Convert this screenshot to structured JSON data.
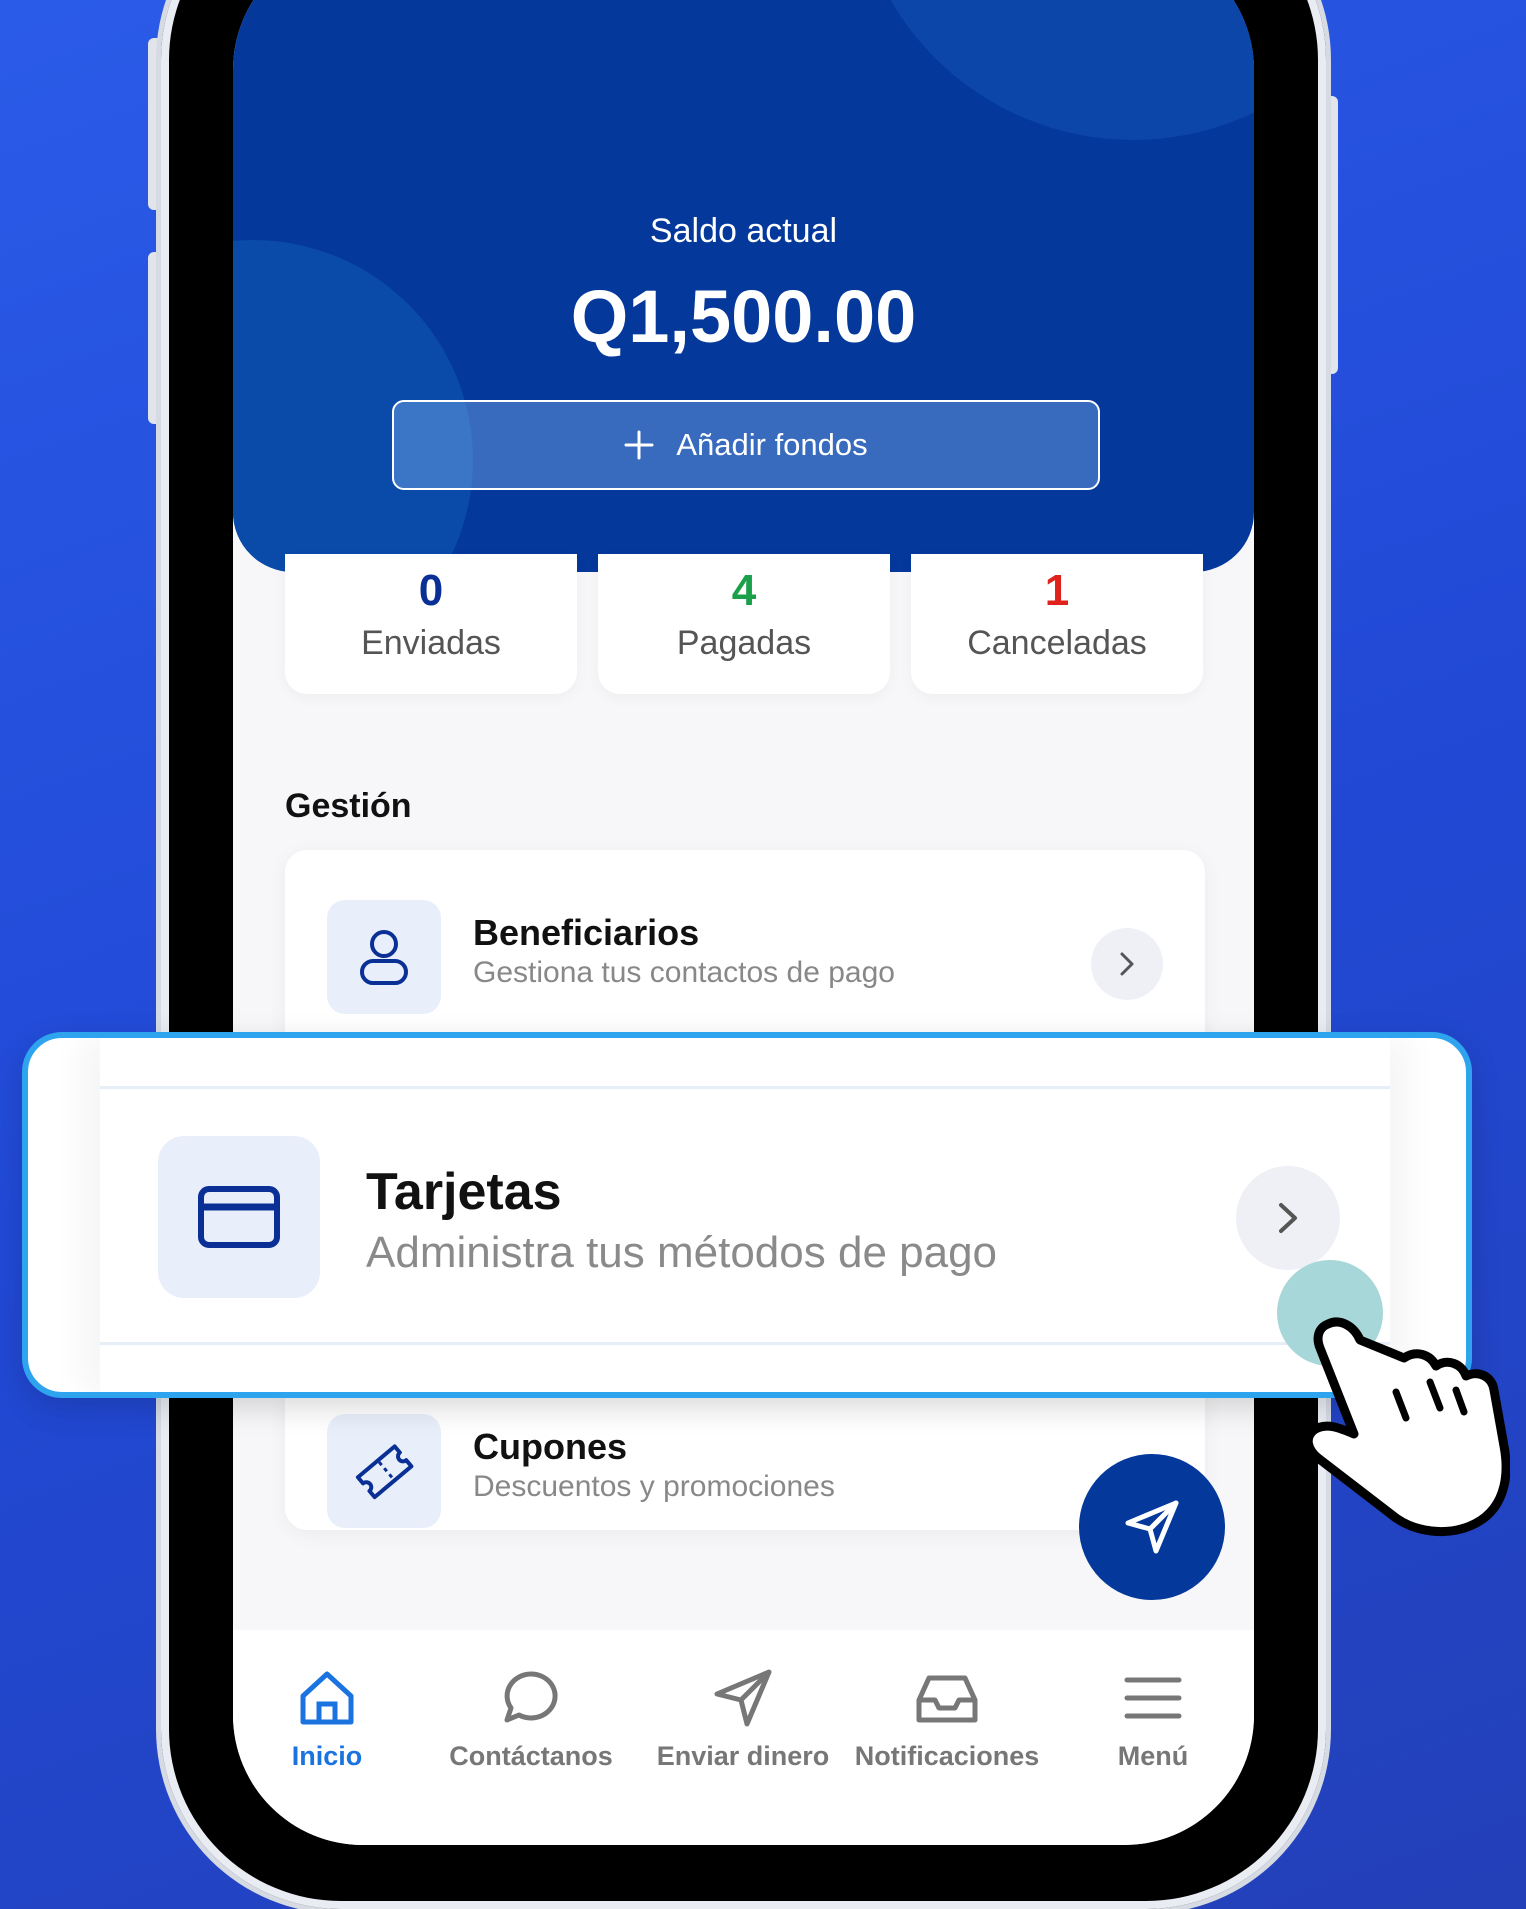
{
  "header": {
    "balance_label": "Saldo actual",
    "balance_amount": "Q1,500.00",
    "add_funds_label": "Añadir fondos"
  },
  "stats": [
    {
      "value": "0",
      "label": "Enviadas",
      "color": "#0a2f95"
    },
    {
      "value": "4",
      "label": "Pagadas",
      "color": "#1aa04a"
    },
    {
      "value": "1",
      "label": "Canceladas",
      "color": "#e0221d"
    }
  ],
  "section": {
    "title": "Gestión"
  },
  "rows": [
    {
      "title": "Beneficiarios",
      "subtitle": "Gestiona tus contactos de pago",
      "icon": "user-icon"
    },
    {
      "title": "Tarjetas",
      "subtitle": "Administra tus métodos de pago",
      "icon": "credit-card-icon"
    },
    {
      "title": "Cupones",
      "subtitle": "Descuentos y promociones",
      "icon": "ticket-icon"
    }
  ],
  "tabs": [
    {
      "label": "Inicio",
      "icon": "home-icon",
      "active": true
    },
    {
      "label": "Contáctanos",
      "icon": "chat-icon"
    },
    {
      "label": "Enviar dinero",
      "icon": "send-icon"
    },
    {
      "label": "Notificaciones",
      "icon": "inbox-icon"
    },
    {
      "label": "Menú",
      "icon": "menu-icon"
    }
  ],
  "colors": {
    "primary": "#04389b",
    "accent": "#1b73e0",
    "highlight_border": "#2ea3ee"
  }
}
